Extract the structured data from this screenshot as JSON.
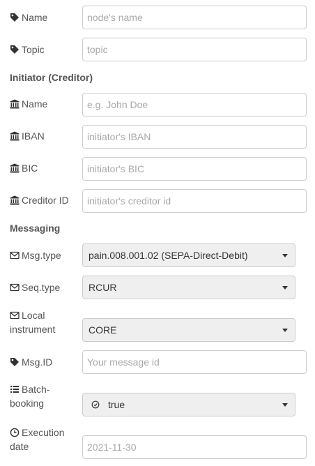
{
  "form": {
    "name": {
      "label": "Name",
      "placeholder": "node's name",
      "value": ""
    },
    "topic": {
      "label": "Topic",
      "placeholder": "topic",
      "value": ""
    }
  },
  "initiator": {
    "heading": "Initiator (Creditor)",
    "name": {
      "label": "Name",
      "placeholder": "e.g. John Doe",
      "value": ""
    },
    "iban": {
      "label": "IBAN",
      "placeholder": "initiator's IBAN",
      "value": ""
    },
    "bic": {
      "label": "BIC",
      "placeholder": "initiator's BIC",
      "value": ""
    },
    "creditor_id": {
      "label": "Creditor ID",
      "placeholder": "initiator's creditor id",
      "value": ""
    }
  },
  "messaging": {
    "heading": "Messaging",
    "msg_type": {
      "label": "Msg.type",
      "value": "pain.008.001.02 (SEPA-Direct-Debit)"
    },
    "seq_type": {
      "label": "Seq.type",
      "value": "RCUR"
    },
    "local_instrument": {
      "label_line1": "Local",
      "label_line2": "instrument",
      "value": "CORE"
    },
    "msg_id": {
      "label": "Msg.ID",
      "placeholder": "Your message id",
      "value": ""
    },
    "batch_booking": {
      "label_line1": "Batch-",
      "label_line2": "booking",
      "value": "true"
    },
    "execution_date": {
      "label_line1": "Execution",
      "label_line2": "date",
      "value": "2021-11-30"
    }
  },
  "icons": {
    "tag": "tag-icon",
    "bank": "bank-icon",
    "envelope": "envelope-icon",
    "list": "list-icon",
    "clock": "clock-icon",
    "radio": "radio-icon",
    "caret": "caret-down-icon"
  }
}
